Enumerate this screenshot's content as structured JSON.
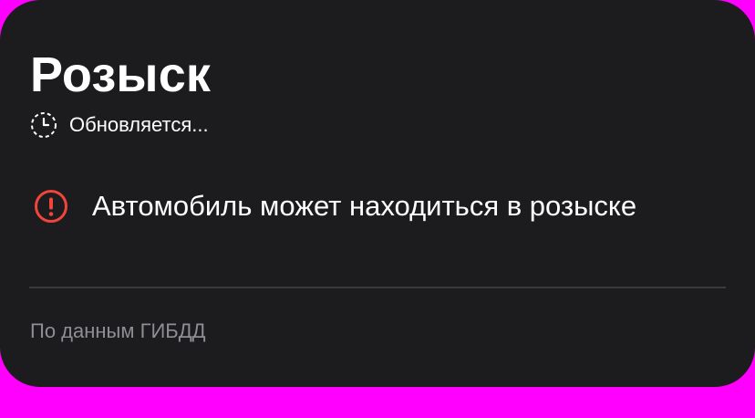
{
  "card": {
    "title": "Розыск",
    "status": {
      "icon": "clock-dashed-icon",
      "text": "Обновляется..."
    },
    "alert": {
      "icon": "exclamation-circle-icon",
      "icon_color": "#f0443c",
      "text": "Автомобиль может находиться в розыске"
    },
    "source_text": "По данным ГИБДД"
  },
  "colors": {
    "card_background": "#1c1c1e",
    "page_background": "#ff00ff",
    "primary_text": "#ffffff",
    "secondary_text": "#8e8e93",
    "alert": "#f0443c"
  }
}
